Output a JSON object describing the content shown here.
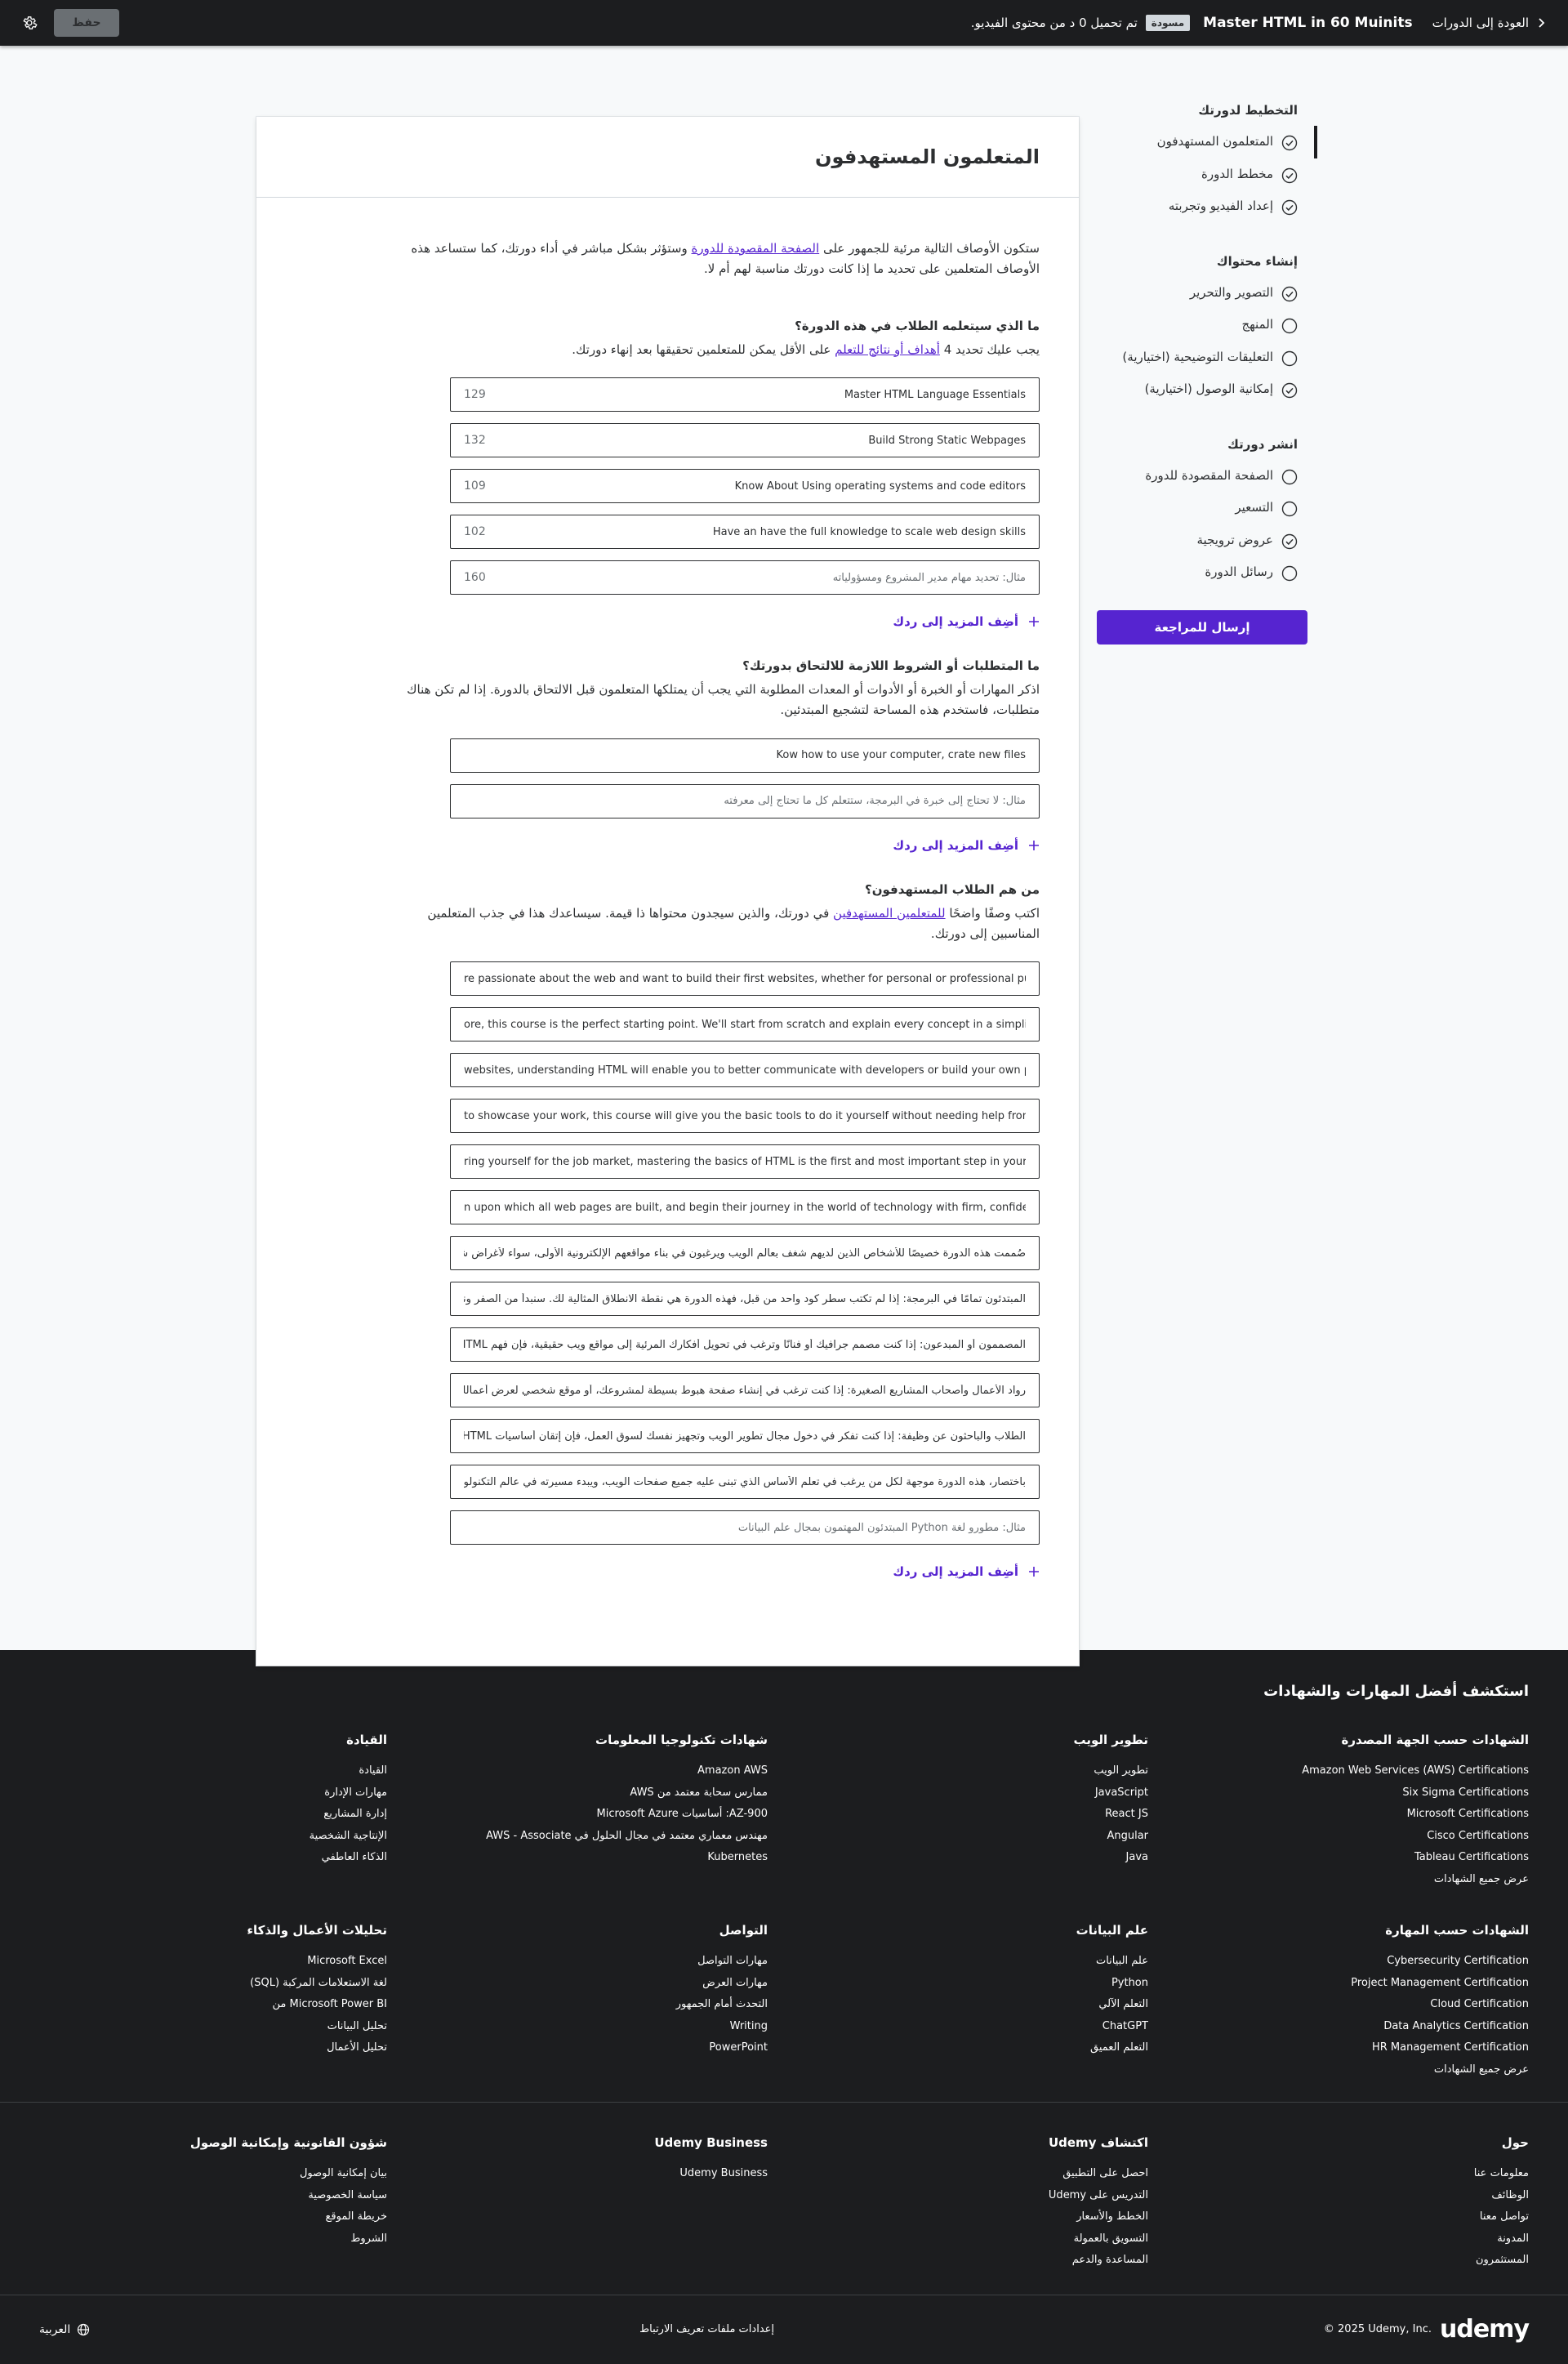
{
  "topbar": {
    "back_label": "العودة إلى الدورات",
    "course_title": "Master HTML in 60 Muinits",
    "draft_badge": "مسودة",
    "upload_status": "تم تحميل 0 د من محتوى الفيديو.",
    "save_label": "حفظ",
    "settings_icon": "gear-icon"
  },
  "sidebar": {
    "groups": [
      {
        "title": "التخطيط لدورتك",
        "items": [
          {
            "label": "المتعلمون المستهدفون",
            "checked": true,
            "active": true
          },
          {
            "label": "مخطط الدورة",
            "checked": true
          },
          {
            "label": "إعداد الفيديو وتجربته",
            "checked": true
          }
        ]
      },
      {
        "title": "إنشاء محتواك",
        "items": [
          {
            "label": "التصوير والتحرير",
            "checked": true
          },
          {
            "label": "المنهج",
            "checked": false
          },
          {
            "label": "التعليقات التوضيحية (اختيارية)",
            "checked": false
          },
          {
            "label": "إمكانية الوصول (اختيارية)",
            "checked": true
          }
        ]
      },
      {
        "title": "انشر دورتك",
        "items": [
          {
            "label": "الصفحة المقصودة للدورة",
            "checked": false
          },
          {
            "label": "التسعير",
            "checked": false
          },
          {
            "label": "عروض ترويجية",
            "checked": true
          },
          {
            "label": "رسائل الدورة",
            "checked": false
          }
        ]
      }
    ],
    "submit_label": "إرسال للمراجعة"
  },
  "card": {
    "title": "المتعلمون المستهدفون",
    "intro_a": "ستكون الأوصاف التالية مرئية للجمهور على ",
    "intro_link": "الصفحة المقصودة للدورة",
    "intro_b": " وستؤثر بشكل مباشر في أداء دورتك، كما ستساعد هذه الأوصاف المتعلمين على تحديد ما إذا كانت دورتك مناسبة لهم أم لا.",
    "add_more": "أضِف المزيد إلى ردك",
    "q1": {
      "title": "ما الذي سيتعلمه الطلاب في هذه الدورة؟",
      "desc_a": "يجب عليك تحديد 4 ",
      "desc_link": "أهداف أو نتائج للتعلم",
      "desc_b": " على الأقل يمكن للمتعلمين تحقيقها بعد إنهاء دورتك.",
      "fields": [
        {
          "value": "Master HTML Language Essentials",
          "count": "129"
        },
        {
          "value": "Build Strong Static Webpages",
          "count": "132"
        },
        {
          "value": "Know About Using operating systems and code editors",
          "count": "109"
        },
        {
          "value": "Have an have the full knowledge to scale web design skills",
          "count": "102"
        }
      ],
      "placeholder": "مثال: تحديد مهام مدير المشروع ومسؤولياته",
      "placeholder_count": "160"
    },
    "q2": {
      "title": "ما المتطلبات أو الشروط اللازمة للالتحاق بدورتك؟",
      "desc": "اذكر المهارات أو الخبرة أو الأدوات أو المعدات المطلوبة التي يجب أن يمتلكها المتعلمون قبل الالتحاق بالدورة. إذا لم تكن هناك متطلبات، فاستخدم هذه المساحة لتشجيع المبتدئين.",
      "fields": [
        {
          "value": "Kow how to use your computer, crate new files"
        }
      ],
      "placeholder": "مثال: لا تحتاج إلى خبرة في البرمجة، ستتعلم كل ما تحتاج إلى معرفته"
    },
    "q3": {
      "title": "من هم الطلاب المستهدفون؟",
      "desc_a": "اكتب وصفًا واضحًا ",
      "desc_link": "للمتعلمين المستهدفين",
      "desc_b": " في دورتك، والذين سيجدون محتواها ذا قيمة. سيساعدك هذا في جذب المتعلمين المناسبين إلى دورتك.",
      "fields_en": [
        "re passionate about the web and want to build their first websites, whether for personal or professional purposes",
        "ore, this course is the perfect starting point. We'll start from scratch and explain every concept in a simplified way",
        "websites, understanding HTML will enable you to better communicate with developers or build your own projects",
        "to showcase your work, this course will give you the basic tools to do it yourself without needing help from others",
        "ring yourself for the job market, mastering the basics of HTML is the first and most important step in your journey",
        "n upon which all web pages are built, and begin their journey in the world of technology with firm, confident steps"
      ],
      "fields_ar": [
        "صُممت هذه الدورة خصيصًا للأشخاص الذين لديهم شغف بعالم الويب ويرغبون في بناء مواقعهم الإلكترونية الأولى، سواء لأغراض شخصية",
        "المبتدئون تمامًا في البرمجة: إذا لم تكتب سطر كود واحد من قبل، فهذه الدورة هي نقطة الانطلاق المثالية لك. سنبدأ من الصفر ونشرح",
        "المصممون أو المبدعون: إذا كنت مصمم جرافيك أو فنانًا وترغب في تحويل أفكارك المرئية إلى مواقع ويب حقيقية، فإن فهم HTML",
        "رواد الأعمال وأصحاب المشاريع الصغيرة: إذا كنت ترغب في إنشاء صفحة هبوط بسيطة لمشروعك، أو موقع شخصي لعرض أعمالك",
        "الطلاب والباحثون عن وظيفة: إذا كنت تفكر في دخول مجال تطوير الويب وتجهيز نفسك لسوق العمل، فإن إتقان أساسيات HTML",
        "باختصار، هذه الدورة موجهة لكل من يرغب في تعلم الأساس الذي تبنى عليه جميع صفحات الويب، ويبدء مسيرته في عالم التكنولوجيا"
      ],
      "placeholder": "مثال: مطورو لغة Python المبتدئون المهتمون بمجال علم البيانات"
    }
  },
  "footer": {
    "heading": "استكشف أفضل المهارات والشهادات",
    "row1": [
      {
        "title": "الشهادات حسب الجهة المصدرة",
        "items": [
          "Amazon Web Services (AWS) Certifications",
          "Six Sigma Certifications",
          "Microsoft Certifications",
          "Cisco Certifications",
          "Tableau Certifications",
          "عرض جميع الشهادات"
        ]
      },
      {
        "title": "تطوير الويب",
        "items": [
          "تطوير الويب",
          "JavaScript",
          "React JS",
          "Angular",
          "Java"
        ]
      },
      {
        "title": "شهادات تكنولوجيا المعلومات",
        "items": [
          "Amazon AWS",
          "ممارس سحابة معتمد من AWS",
          "AZ-900: أساسيات Microsoft Azure",
          "مهندس معماري معتمد في مجال الحلول في AWS - Associate",
          "Kubernetes"
        ]
      },
      {
        "title": "القيادة",
        "items": [
          "القيادة",
          "مهارات الإدارة",
          "إدارة المشاريع",
          "الإنتاجية الشخصية",
          "الذكاء العاطفي"
        ]
      }
    ],
    "row2": [
      {
        "title": "الشهادات حسب المهارة",
        "items": [
          "Cybersecurity Certification",
          "Project Management Certification",
          "Cloud Certification",
          "Data Analytics Certification",
          "HR Management Certification",
          "عرض جميع الشهادات"
        ]
      },
      {
        "title": "علم البيانات",
        "items": [
          "علم البيانات",
          "Python",
          "التعلم الآلي",
          "ChatGPT",
          "التعلم العميق"
        ]
      },
      {
        "title": "التواصل",
        "items": [
          "مهارات التواصل",
          "مهارات العرض",
          "التحدث أمام الجمهور",
          "Writing",
          "PowerPoint"
        ]
      },
      {
        "title": "تحليلات الأعمال والذكاء",
        "items": [
          "Microsoft Excel",
          "لغة الاستعلامات المركبة (SQL)",
          "Microsoft Power BI من",
          "تحليل البيانات",
          "تحليل الأعمال"
        ]
      }
    ],
    "row3": [
      {
        "title": "حول",
        "items": [
          "معلومات عنا",
          "الوظائف",
          "تواصل معنا",
          "المدونة",
          "المستثمرون"
        ]
      },
      {
        "title": "اكتشاف Udemy",
        "items": [
          "احصل على التطبيق",
          "التدريس على Udemy",
          "الخطط والأسعار",
          "التسويق بالعمولة",
          "المساعدة والدعم"
        ]
      },
      {
        "title": "Udemy Business",
        "items": [
          "Udemy Business"
        ]
      },
      {
        "title": "شؤون القانونية وإمكانية الوصول",
        "items": [
          "بيان إمكانية الوصول",
          "سياسة الخصوصية",
          "خريطة الموقع",
          "الشروط"
        ]
      }
    ],
    "logo_text": "udemy",
    "copyright": "© 2025 Udemy, Inc.",
    "cookie_settings": "إعدادات ملفات تعريف الارتباط",
    "language": "العربية",
    "colors": {
      "accent": "#5624d0",
      "dark": "#1c1d1f",
      "logo_accent": "#a435f0"
    }
  }
}
